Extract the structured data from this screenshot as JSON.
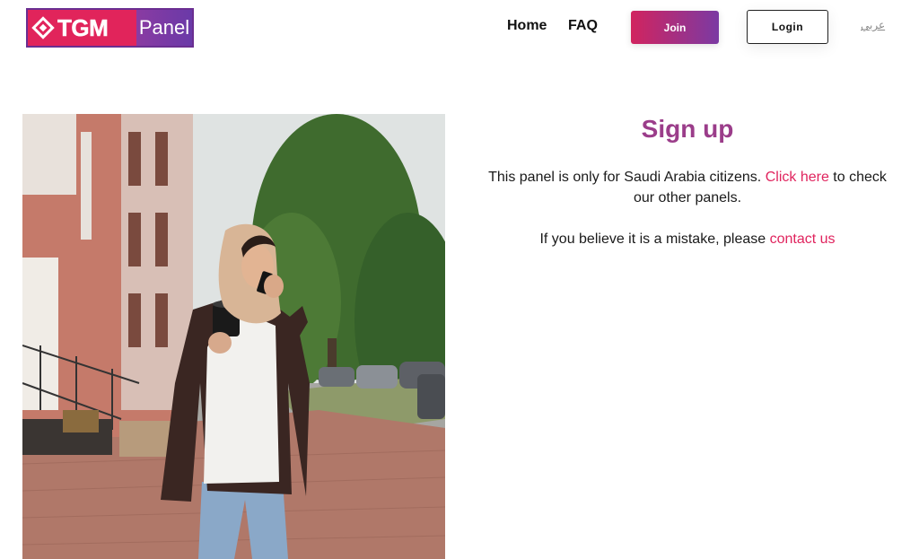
{
  "header": {
    "logo": {
      "brand": "TGM",
      "product": "Panel"
    },
    "nav": [
      {
        "label": "Home"
      },
      {
        "label": "FAQ"
      }
    ],
    "join_label": "Join",
    "login_label": "Login",
    "language_label": "عربي"
  },
  "main": {
    "title": "Sign up",
    "notice": {
      "before": "This panel is only for Saudi Arabia citizens.",
      "link": "Click here",
      "after": "to check our other panels."
    },
    "mistake": {
      "before": "If you believe it is a mistake, please",
      "link": "contact us"
    }
  },
  "colors": {
    "accent_pink": "#e0245e",
    "title_purple": "#9b3d8a",
    "logo_purple": "#6a2e91"
  }
}
